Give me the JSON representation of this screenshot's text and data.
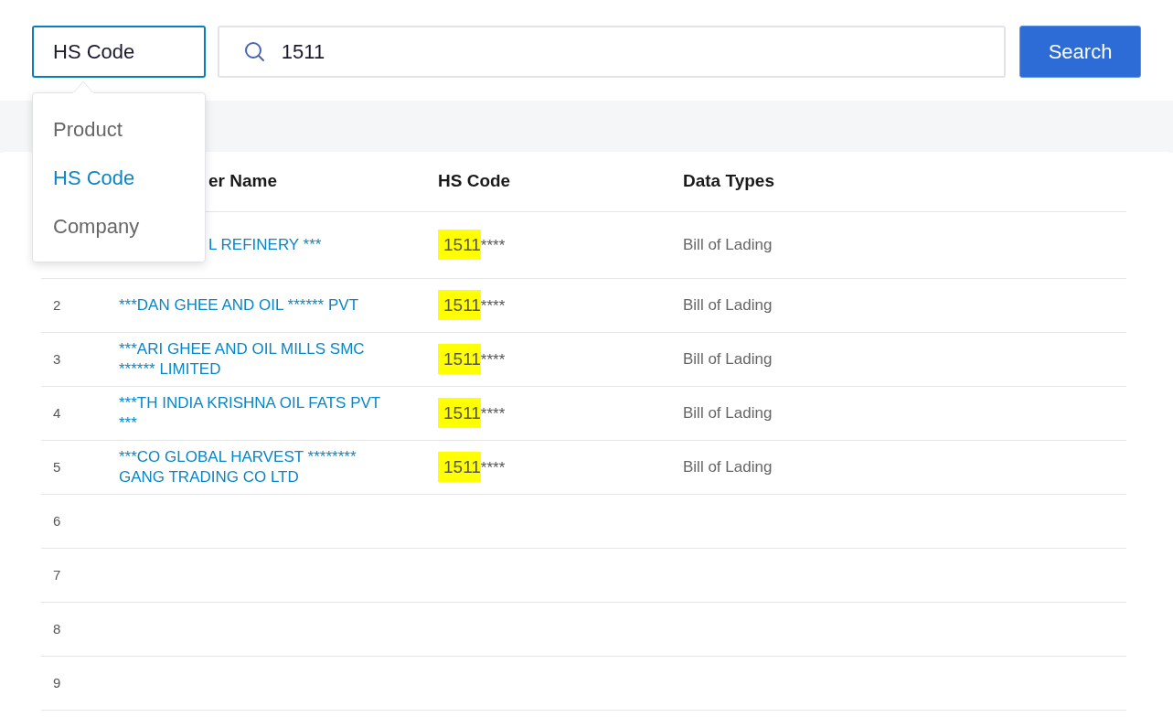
{
  "search_bar": {
    "type_select": {
      "value": "HS Code",
      "expanded": true
    },
    "query": {
      "value": "1511"
    },
    "button": "Search"
  },
  "type_menu": [
    {
      "label": "Product",
      "selected": false
    },
    {
      "label": "HS Code",
      "selected": true
    },
    {
      "label": "Company",
      "selected": false
    }
  ],
  "table": {
    "columns": [
      "er Name",
      "HS Code",
      "Data Types"
    ],
    "rows": [
      {
        "name": "L REFINERY ***",
        "hs_match": "1511",
        "hs_rest": "****",
        "data_type": "Bill of Lading"
      },
      {
        "number": "2",
        "name": "***DAN GHEE AND OIL ****** PVT",
        "hs_match": "1511",
        "hs_rest": "****",
        "data_type": "Bill of Lading"
      },
      {
        "number": "3",
        "name": "***ARI GHEE AND OIL MILLS SMC ****** LIMITED",
        "hs_match": "1511",
        "hs_rest": "****",
        "data_type": "Bill of Lading"
      },
      {
        "number": "4",
        "name": "***TH INDIA KRISHNA OIL FATS PVT ***",
        "hs_match": "1511",
        "hs_rest": "****",
        "data_type": "Bill of Lading"
      },
      {
        "number": "5",
        "name": "***CO GLOBAL HARVEST ******** GANG TRADING CO LTD",
        "hs_match": "1511",
        "hs_rest": "****",
        "data_type": "Bill of Lading"
      },
      {
        "number": "6"
      },
      {
        "number": "7"
      },
      {
        "number": "8"
      },
      {
        "number": "9"
      }
    ]
  }
}
